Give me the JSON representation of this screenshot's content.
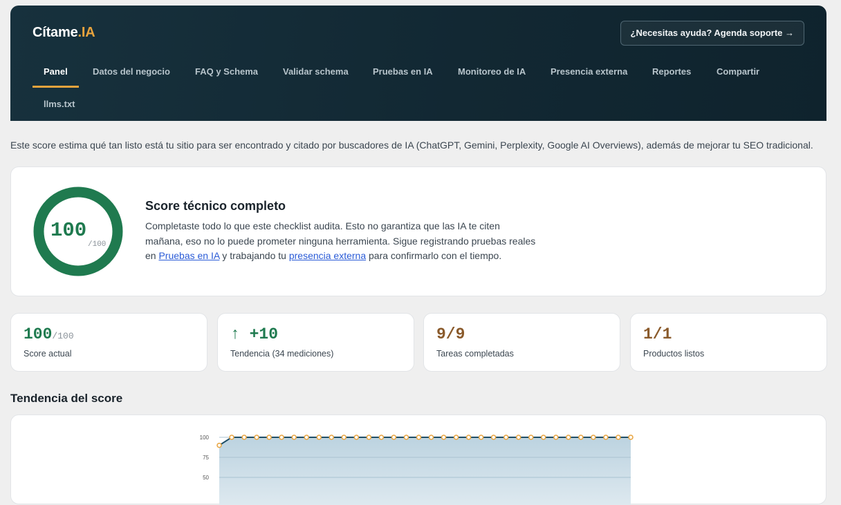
{
  "header": {
    "logo_main": "Cítame",
    "logo_accent": ".IA",
    "support_label": "¿Necesitas ayuda? Agenda soporte →",
    "accent_color": "#e8a33d"
  },
  "nav": {
    "items": [
      {
        "label": "Panel",
        "active": true
      },
      {
        "label": "Datos del negocio"
      },
      {
        "label": "FAQ y Schema"
      },
      {
        "label": "Validar schema"
      },
      {
        "label": "Pruebas en IA"
      },
      {
        "label": "Monitoreo de IA"
      },
      {
        "label": "Presencia externa"
      },
      {
        "label": "Reportes"
      },
      {
        "label": "Compartir"
      },
      {
        "label": "llms.txt"
      }
    ]
  },
  "intro": "Este score estima qué tan listo está tu sitio para ser encontrado y citado por buscadores de IA (ChatGPT, Gemini, Perplexity, Google AI Overviews), además de mejorar tu SEO tradicional.",
  "score": {
    "value": "100",
    "max": "/100",
    "fraction": 1.0,
    "ring_color": "#1f7a4f",
    "title": "Score técnico completo",
    "desc_part1": "Completaste todo lo que este checklist audita. Esto no garantiza que las IA te citen mañana, eso no lo puede prometer ninguna herramienta. Sigue registrando pruebas reales en ",
    "link1": "Pruebas en IA",
    "desc_part2": " y trabajando tu ",
    "link2": "presencia externa",
    "desc_part3": " para confirmarlo con el tiempo."
  },
  "stats": [
    {
      "value": "100",
      "suffix": "/100",
      "label": "Score actual"
    },
    {
      "value": "↑ +10",
      "label": "Tendencia (34 mediciones)"
    },
    {
      "value": "9/9",
      "label": "Tareas completadas"
    },
    {
      "value": "1/1",
      "label": "Productos listos"
    }
  ],
  "trend": {
    "title": "Tendencia del score"
  },
  "chart_data": {
    "type": "area",
    "y_ticks": [
      "100",
      "75",
      "50"
    ],
    "ylim": [
      0,
      100
    ],
    "grid": true,
    "line_color": "#1f4e66",
    "point_color": "#e8a33d",
    "values": [
      90,
      100,
      100,
      100,
      100,
      100,
      100,
      100,
      100,
      100,
      100,
      100,
      100,
      100,
      100,
      100,
      100,
      100,
      100,
      100,
      100,
      100,
      100,
      100,
      100,
      100,
      100,
      100,
      100,
      100,
      100,
      100,
      100,
      100
    ]
  }
}
